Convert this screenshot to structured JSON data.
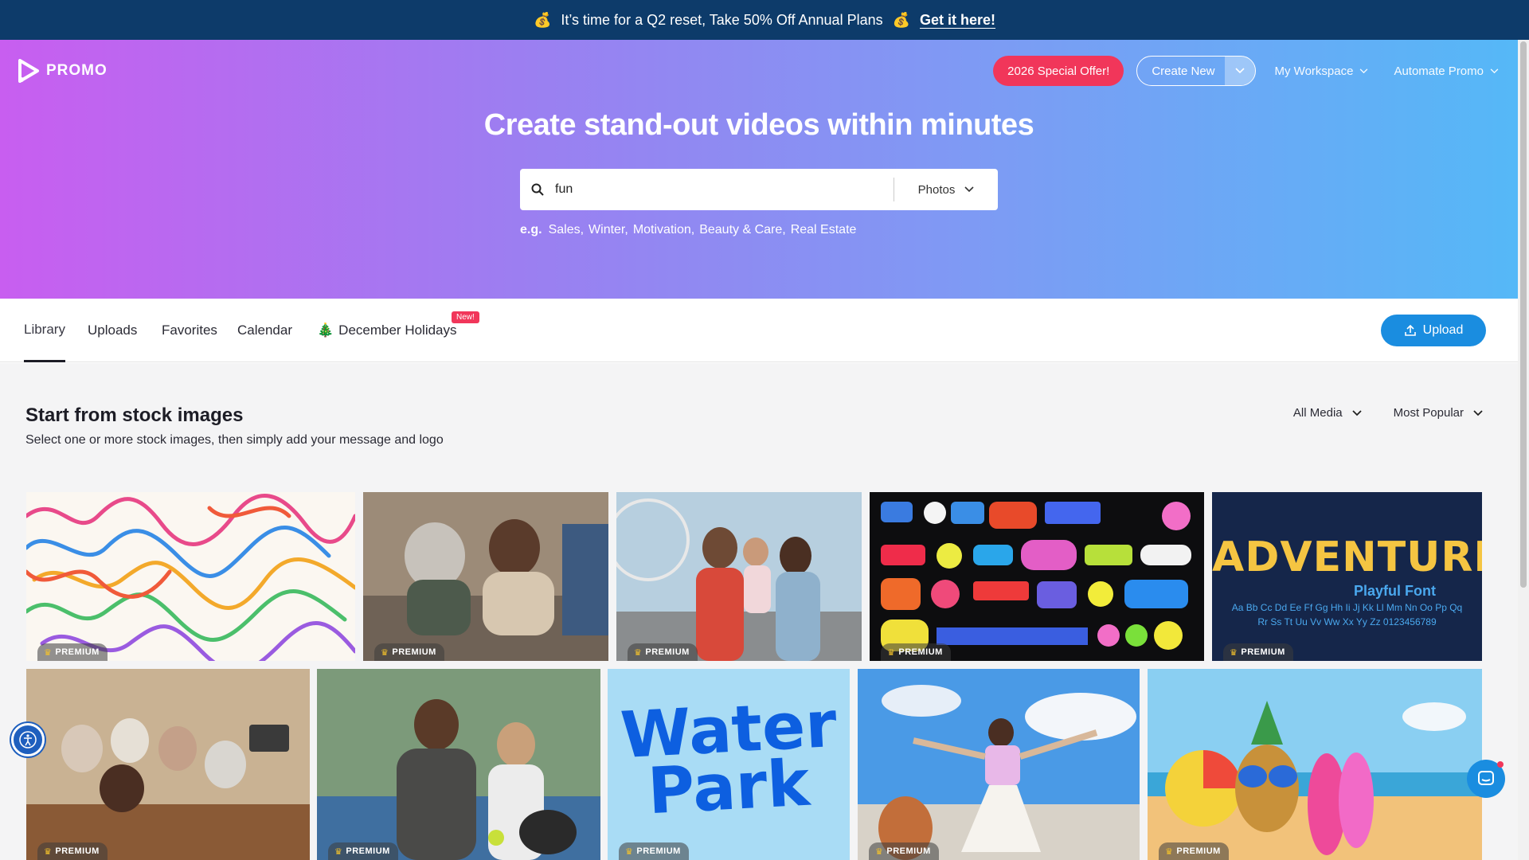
{
  "banner": {
    "emoji_left": "💰",
    "text": "It’s time for a Q2 reset, Take 50% Off Annual Plans",
    "emoji_right": "💰",
    "cta": "Get it here!"
  },
  "header": {
    "logo_text": "PROMO",
    "special_offer": "2026 Special Offer!",
    "create_new": "Create New",
    "my_workspace": "My Workspace",
    "automate_promo": "Automate Promo"
  },
  "hero": {
    "title": "Create stand-out videos within minutes",
    "search_value": "fun",
    "media_type": "Photos",
    "eg_label": "e.g.",
    "suggestions": [
      "Sales,",
      "Winter,",
      "Motivation,",
      "Beauty & Care,",
      "Real Estate"
    ]
  },
  "tabs": {
    "library": "Library",
    "uploads": "Uploads",
    "favorites": "Favorites",
    "calendar": "Calendar",
    "december_holidays": "December Holidays",
    "new_badge": "New!",
    "upload_button": "Upload"
  },
  "content": {
    "title": "Start from stock images",
    "subtitle": "Select one or more stock images, then simply add your message and logo",
    "filter_media": "All Media",
    "filter_sort": "Most Popular",
    "premium_label": "PREMIUM",
    "adventure_title": "ADVENTURE",
    "adventure_sub": "Playful Font",
    "adventure_abc1": "Aa Bb Cc Dd Ee Ff Gg Hh Ii Jj Kk Ll Mm Nn Oo Pp Qq",
    "adventure_abc2": "Rr Ss Tt Uu Vv Ww Xx Yy Zz 0123456789",
    "waterpark_line1": "Water",
    "waterpark_line2": "Park"
  },
  "colors": {
    "banner_bg": "#0d3b6a",
    "special_offer": "#f1365a",
    "upload_button": "#1a8de0",
    "hero_gradient_start": "#c85ef0",
    "hero_gradient_end": "#55b8f7"
  }
}
